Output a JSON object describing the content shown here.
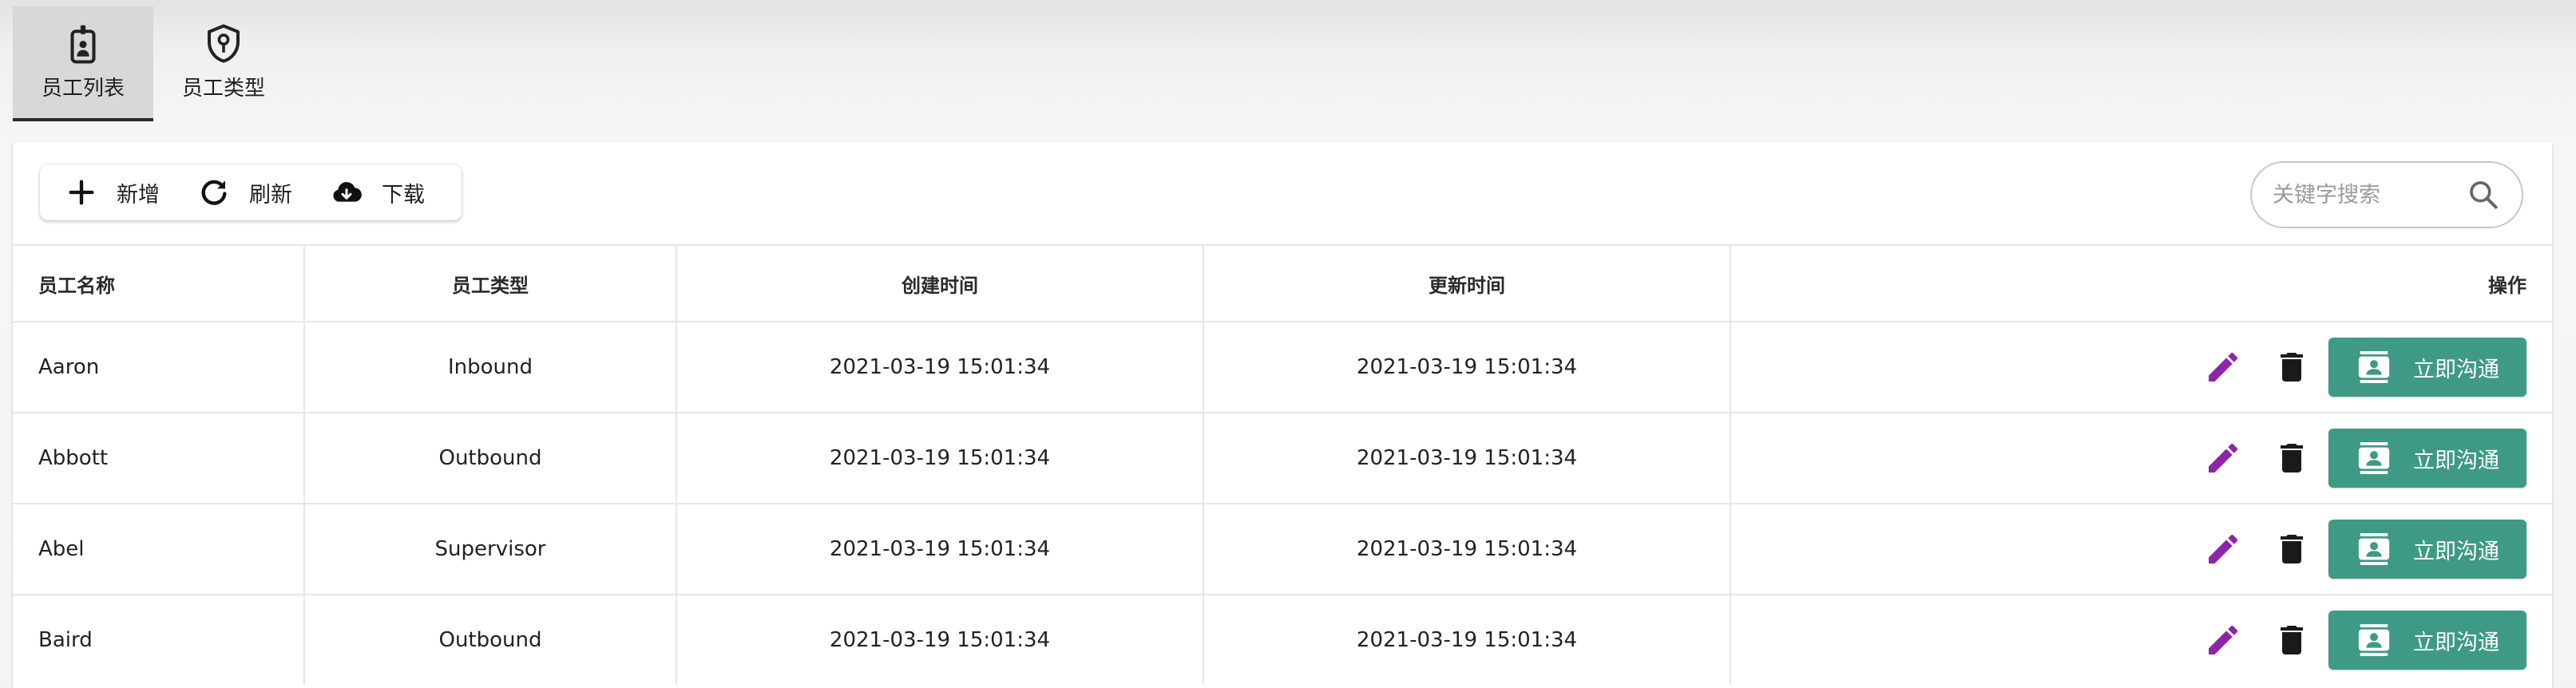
{
  "tabs": [
    {
      "label": "员工列表",
      "icon": "badge-icon",
      "active": true
    },
    {
      "label": "员工类型",
      "icon": "shield-person-icon",
      "active": false
    }
  ],
  "toolbar": {
    "add_label": "新增",
    "refresh_label": "刷新",
    "download_label": "下载"
  },
  "search": {
    "placeholder": "关键字搜索",
    "value": ""
  },
  "table": {
    "columns": [
      "员工名称",
      "员工类型",
      "创建时间",
      "更新时间",
      "操作"
    ],
    "rows": [
      {
        "name": "Aaron",
        "type": "Inbound",
        "created": "2021-03-19 15:01:34",
        "updated": "2021-03-19 15:01:34"
      },
      {
        "name": "Abbott",
        "type": "Outbound",
        "created": "2021-03-19 15:01:34",
        "updated": "2021-03-19 15:01:34"
      },
      {
        "name": "Abel",
        "type": "Supervisor",
        "created": "2021-03-19 15:01:34",
        "updated": "2021-03-19 15:01:34"
      },
      {
        "name": "Baird",
        "type": "Outbound",
        "created": "2021-03-19 15:01:34",
        "updated": "2021-03-19 15:01:34"
      }
    ],
    "chat_label": "立即沟通"
  },
  "colors": {
    "accent_green": "#3e9a84",
    "edit_purple": "#8e24aa",
    "delete_black": "#1a1a1a",
    "tab_active_bg": "#d8d8d8"
  }
}
